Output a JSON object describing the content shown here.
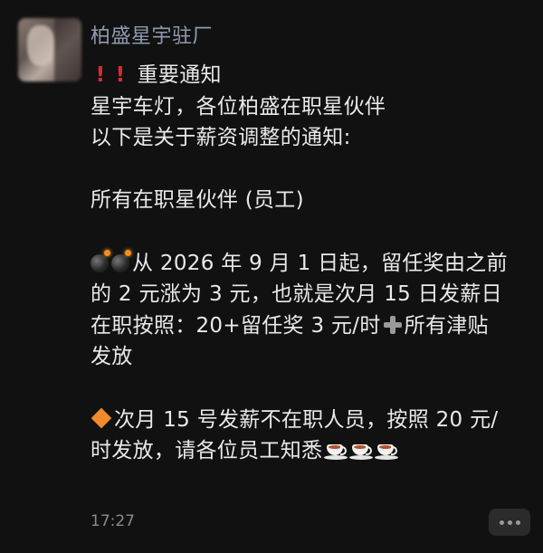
{
  "message": {
    "sender": "柏盛星宇驻厂",
    "time": "17:27",
    "title_text": "重要通知",
    "lines": {
      "l2": "星宇车灯，各位柏盛在职星伙伴",
      "l3": "以下是关于薪资调整的通知:",
      "l4": "所有在职星伙伴 (员工)",
      "l5": "从 2026 年 9 月 1 日起，留任奖由之前",
      "l6": "的 2 元涨为 3 元，也就是次月 15 日发薪日",
      "l7a": "在职按照：20+留任奖 3 元/时",
      "l7b": "所有津贴",
      "l8": "发放",
      "l9": "次月 15 号发薪不在职人员，按照 20 元/",
      "l10": "时发放，请各位员工知悉"
    },
    "emoji": {
      "title_prefix": "exclamation-icon",
      "bomb": "bomb-icon",
      "plus": "plus-icon",
      "diamond": "orange-diamond-icon",
      "tea": "tea-cup-icon"
    }
  },
  "colors": {
    "background": "#111111",
    "sender": "#8f9bb0",
    "text": "#e9e9e9",
    "exclamation": "#e0292f",
    "diamond": "#f08a2a"
  }
}
